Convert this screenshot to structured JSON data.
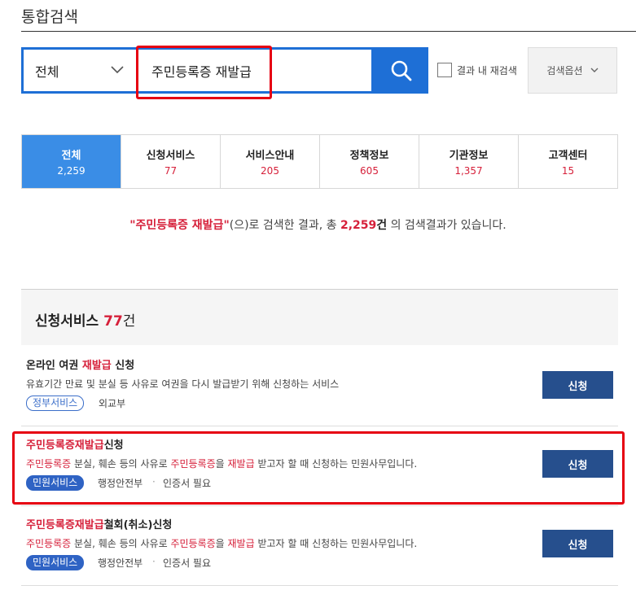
{
  "header": {
    "title": "통합검색"
  },
  "search": {
    "category": "전체",
    "query": "주민등록증 재발급",
    "re_search_label": "결과 내 재검색",
    "options_label": "검색옵션"
  },
  "tabs": [
    {
      "label": "전체",
      "count": "2,259"
    },
    {
      "label": "신청서비스",
      "count": "77"
    },
    {
      "label": "서비스안내",
      "count": "205"
    },
    {
      "label": "정책정보",
      "count": "605"
    },
    {
      "label": "기관정보",
      "count": "1,357"
    },
    {
      "label": "고객센터",
      "count": "15"
    }
  ],
  "summary": {
    "keyword": "\"주민등록증 재발급\"",
    "text1": "(으)로 검색한 결과, 총 ",
    "total": "2,259",
    "unit": "건",
    "text2": " 의 검색결과가 있습니다."
  },
  "section": {
    "title": "신청서비스",
    "count": "77",
    "unit": "건"
  },
  "items": [
    {
      "title_pre": "온라인 여권 ",
      "title_hl": "재발급",
      "title_post": " 신청",
      "desc": "유효기간 만료 및 분실 등 사유로 여권을 다시 발급받기 위해 신청하는 서비스",
      "tag": "정부서비스",
      "org": "외교부",
      "button": "신청"
    },
    {
      "title_hl": "주민등록증재발급",
      "title_post": "신청",
      "desc_hl1": "주민등록증",
      "desc_mid1": " 분실, 훼손 등의 사유로 ",
      "desc_hl2": "주민등록증",
      "desc_mid2": "을 ",
      "desc_hl3": "재발급",
      "desc_post": " 받고자 할 때 신청하는 민원사무입니다.",
      "tag": "민원서비스",
      "org": "행정안전부",
      "cert": "인증서 필요",
      "button": "신청"
    },
    {
      "title_hl": "주민등록증재발급",
      "title_post": "철회(취소)신청",
      "desc_hl1": "주민등록증",
      "desc_mid1": " 분실, 훼손 등의 사유로 ",
      "desc_hl2": "주민등록증",
      "desc_mid2": "을 ",
      "desc_hl3": "재발급",
      "desc_post": " 받고자 할 때 신청하는 민원사무입니다.",
      "tag": "민원서비스",
      "org": "행정안전부",
      "cert": "인증서 필요",
      "button": "신청"
    }
  ],
  "colors": {
    "accent": "#1e6fd6",
    "tab_active": "#3a8de6",
    "highlight": "#d6203a",
    "button": "#264f8d",
    "annotation": "#e60012"
  }
}
